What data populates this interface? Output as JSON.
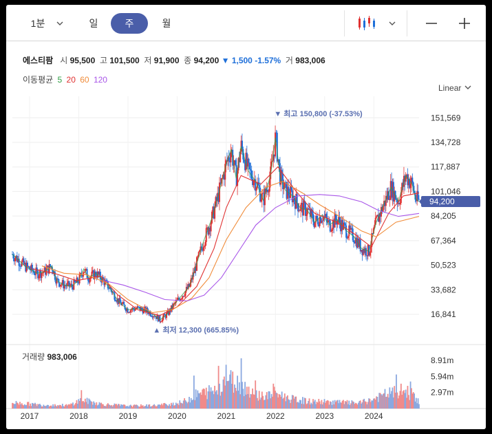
{
  "toolbar": {
    "intervals": [
      "1분",
      "일",
      "주",
      "월"
    ],
    "selected": "주"
  },
  "stock": {
    "name": "에스티팜",
    "open_label": "시",
    "open": "95,500",
    "high_label": "고",
    "high": "101,500",
    "low_label": "저",
    "low": "91,900",
    "close_label": "종",
    "close": "94,200",
    "change": "▼ 1,500",
    "change_pct": "-1.57%",
    "volume_label": "거",
    "volume": "983,006"
  },
  "moving_average": {
    "label": "이동평균",
    "periods": [
      {
        "period": "5",
        "color": "#2f9e44"
      },
      {
        "period": "20",
        "color": "#e03131"
      },
      {
        "period": "60",
        "color": "#f08c3a"
      },
      {
        "period": "120",
        "color": "#a855e8"
      }
    ]
  },
  "scale_mode": "Linear",
  "chart_data": {
    "type": "candlestick",
    "interval": "weekly",
    "y_ticks": [
      "151,569",
      "134,728",
      "117,887",
      "101,046",
      "84,205",
      "67,364",
      "50,523",
      "33,682",
      "16,841"
    ],
    "y_tick_values": [
      151569,
      134728,
      117887,
      101046,
      84205,
      67364,
      50523,
      33682,
      16841
    ],
    "ylim": [
      -3400,
      166300
    ],
    "x_ticks": [
      "2017",
      "2018",
      "2019",
      "2020",
      "2021",
      "2022",
      "2023",
      "2024"
    ],
    "x_range": [
      2016.65,
      2024.92
    ],
    "current_price_label": "94,200",
    "current_price": 94200,
    "annotations": {
      "high": {
        "text": "▼ 최고 150,800 (-37.53%)",
        "value": 150800,
        "x": 2022.0
      },
      "low": {
        "text": "▲ 최저 12,300 (665.85%)",
        "value": 12300,
        "x": 2019.65
      }
    },
    "price_keyframes": [
      [
        2016.65,
        58000
      ],
      [
        2016.75,
        55000
      ],
      [
        2016.9,
        50000
      ],
      [
        2017.0,
        48000
      ],
      [
        2017.15,
        45000
      ],
      [
        2017.3,
        46000
      ],
      [
        2017.45,
        50000
      ],
      [
        2017.55,
        40000
      ],
      [
        2017.7,
        37000
      ],
      [
        2017.85,
        36000
      ],
      [
        2018.0,
        40000
      ],
      [
        2018.1,
        48000
      ],
      [
        2018.2,
        42000
      ],
      [
        2018.35,
        45000
      ],
      [
        2018.5,
        40000
      ],
      [
        2018.65,
        34000
      ],
      [
        2018.8,
        26000
      ],
      [
        2019.0,
        20000
      ],
      [
        2019.2,
        21000
      ],
      [
        2019.4,
        19000
      ],
      [
        2019.55,
        16000
      ],
      [
        2019.65,
        13000
      ],
      [
        2019.8,
        17000
      ],
      [
        2019.95,
        24000
      ],
      [
        2020.1,
        30000
      ],
      [
        2020.25,
        36000
      ],
      [
        2020.4,
        52000
      ],
      [
        2020.55,
        68000
      ],
      [
        2020.7,
        82000
      ],
      [
        2020.85,
        100000
      ],
      [
        2021.0,
        120000
      ],
      [
        2021.1,
        130000
      ],
      [
        2021.2,
        110000
      ],
      [
        2021.3,
        132000
      ],
      [
        2021.45,
        115000
      ],
      [
        2021.6,
        108000
      ],
      [
        2021.75,
        95000
      ],
      [
        2021.9,
        112000
      ],
      [
        2022.0,
        138000
      ],
      [
        2022.1,
        110000
      ],
      [
        2022.2,
        102000
      ],
      [
        2022.35,
        98000
      ],
      [
        2022.5,
        90000
      ],
      [
        2022.65,
        88000
      ],
      [
        2022.8,
        80000
      ],
      [
        2022.95,
        85000
      ],
      [
        2023.1,
        78000
      ],
      [
        2023.25,
        82000
      ],
      [
        2023.45,
        74000
      ],
      [
        2023.6,
        70000
      ],
      [
        2023.75,
        62000
      ],
      [
        2023.9,
        60000
      ],
      [
        2024.05,
        80000
      ],
      [
        2024.2,
        92000
      ],
      [
        2024.35,
        104000
      ],
      [
        2024.5,
        94000
      ],
      [
        2024.65,
        112000
      ],
      [
        2024.78,
        106000
      ],
      [
        2024.85,
        96000
      ],
      [
        2024.92,
        94200
      ]
    ],
    "ma_series": [
      {
        "name": "20",
        "color": "#e03131",
        "points": [
          [
            2017.05,
            48000
          ],
          [
            2017.5,
            45000
          ],
          [
            2017.95,
            40000
          ],
          [
            2018.45,
            43000
          ],
          [
            2018.8,
            30000
          ],
          [
            2019.2,
            20000
          ],
          [
            2019.65,
            16000
          ],
          [
            2020.0,
            22000
          ],
          [
            2020.4,
            36000
          ],
          [
            2020.75,
            62000
          ],
          [
            2021.0,
            90000
          ],
          [
            2021.3,
            112000
          ],
          [
            2021.7,
            106000
          ],
          [
            2022.05,
            118000
          ],
          [
            2022.4,
            102000
          ],
          [
            2022.8,
            86000
          ],
          [
            2023.25,
            80000
          ],
          [
            2023.6,
            72000
          ],
          [
            2023.95,
            63000
          ],
          [
            2024.3,
            86000
          ],
          [
            2024.6,
            98000
          ],
          [
            2024.92,
            100000
          ]
        ]
      },
      {
        "name": "60",
        "color": "#f08c3a",
        "points": [
          [
            2017.25,
            50000
          ],
          [
            2017.7,
            45000
          ],
          [
            2018.15,
            44000
          ],
          [
            2018.6,
            38000
          ],
          [
            2019.0,
            27000
          ],
          [
            2019.5,
            18000
          ],
          [
            2019.9,
            20000
          ],
          [
            2020.3,
            28000
          ],
          [
            2020.65,
            42000
          ],
          [
            2021.0,
            68000
          ],
          [
            2021.4,
            90000
          ],
          [
            2021.8,
            104000
          ],
          [
            2022.15,
            108000
          ],
          [
            2022.55,
            100000
          ],
          [
            2022.9,
            92000
          ],
          [
            2023.3,
            84000
          ],
          [
            2023.75,
            74000
          ],
          [
            2024.05,
            70000
          ],
          [
            2024.45,
            80000
          ],
          [
            2024.92,
            84000
          ]
        ]
      },
      {
        "name": "120",
        "color": "#a855e8",
        "points": [
          [
            2018.5,
            40000
          ],
          [
            2018.9,
            37000
          ],
          [
            2019.35,
            32000
          ],
          [
            2019.75,
            27000
          ],
          [
            2020.2,
            26000
          ],
          [
            2020.55,
            30000
          ],
          [
            2020.9,
            42000
          ],
          [
            2021.25,
            60000
          ],
          [
            2021.6,
            78000
          ],
          [
            2022.0,
            90000
          ],
          [
            2022.45,
            98000
          ],
          [
            2022.9,
            99000
          ],
          [
            2023.3,
            98000
          ],
          [
            2023.75,
            94000
          ],
          [
            2024.1,
            88000
          ],
          [
            2024.5,
            84000
          ],
          [
            2024.92,
            86000
          ]
        ]
      }
    ],
    "volume": {
      "label": "거래량",
      "value": "983,006",
      "ticks": [
        "8.91m",
        "5.94m",
        "2.97m"
      ],
      "tick_values_m": [
        8.91,
        5.94,
        2.97
      ],
      "ylim_m": [
        0,
        11.7
      ],
      "keyframes_m": [
        [
          2016.65,
          1.1
        ],
        [
          2017.2,
          0.7
        ],
        [
          2017.8,
          0.6
        ],
        [
          2018.05,
          1.6
        ],
        [
          2018.5,
          0.8
        ],
        [
          2019.0,
          0.5
        ],
        [
          2019.6,
          0.6
        ],
        [
          2020.1,
          1.1
        ],
        [
          2020.4,
          2.6
        ],
        [
          2020.6,
          3.0
        ],
        [
          2020.8,
          3.5
        ],
        [
          2021.0,
          5.5
        ],
        [
          2021.15,
          5.0
        ],
        [
          2021.4,
          3.8
        ],
        [
          2021.6,
          2.8
        ],
        [
          2021.8,
          2.2
        ],
        [
          2022.0,
          2.9
        ],
        [
          2022.3,
          1.8
        ],
        [
          2022.7,
          1.3
        ],
        [
          2023.2,
          1.2
        ],
        [
          2023.7,
          1.0
        ],
        [
          2024.0,
          1.7
        ],
        [
          2024.3,
          2.8
        ],
        [
          2024.6,
          3.3
        ],
        [
          2024.8,
          2.6
        ],
        [
          2024.92,
          1.1
        ]
      ],
      "spikes_m": [
        [
          2018.05,
          3.4
        ],
        [
          2020.35,
          6.1
        ],
        [
          2020.85,
          7.9
        ],
        [
          2021.0,
          8.1
        ],
        [
          2021.3,
          9.3
        ],
        [
          2021.6,
          5.2
        ],
        [
          2021.95,
          4.6
        ],
        [
          2024.45,
          6.3
        ],
        [
          2024.75,
          5.0
        ]
      ]
    }
  }
}
